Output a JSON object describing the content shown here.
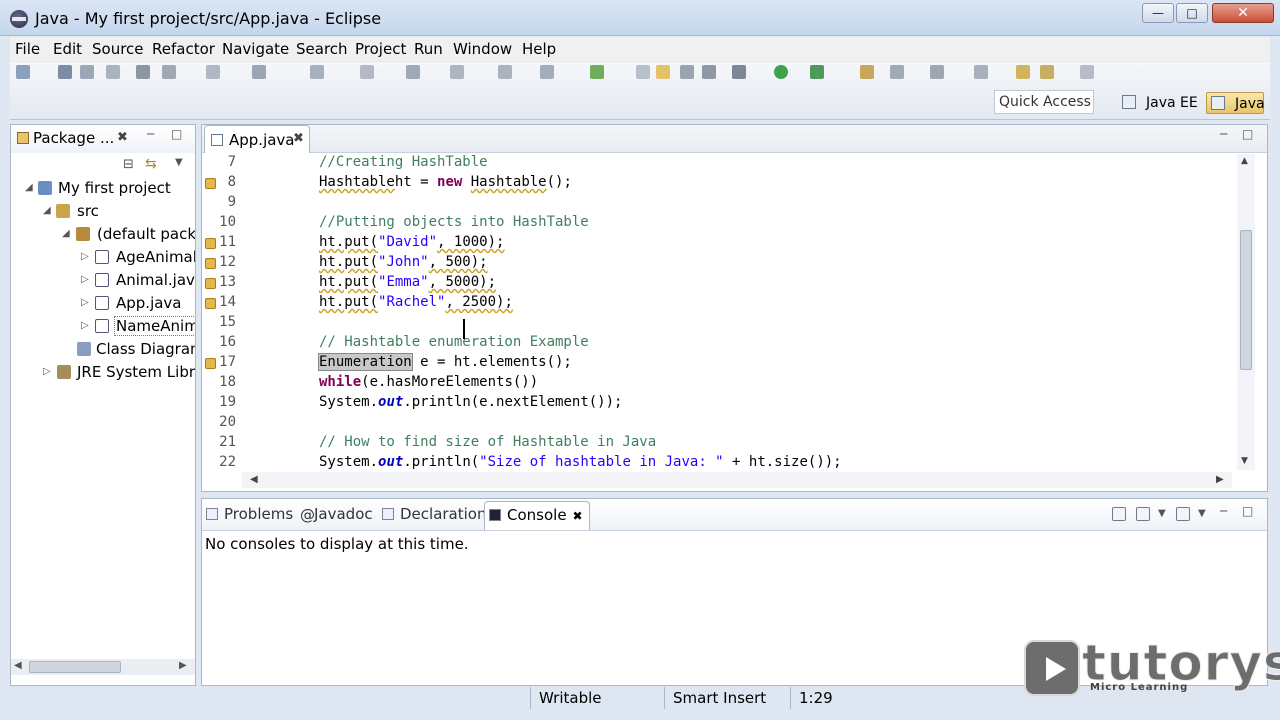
{
  "window": {
    "title": "Java - My first project/src/App.java - Eclipse"
  },
  "menu": [
    "File",
    "Edit",
    "Source",
    "Refactor",
    "Navigate",
    "Search",
    "Project",
    "Run",
    "Window",
    "Help"
  ],
  "toolbar": {
    "quick_access": "Quick Access",
    "perspectives": {
      "javaee": "Java EE",
      "java": "Java"
    }
  },
  "package_explorer": {
    "tab_label": "Package ...",
    "items": [
      {
        "label": "My first project",
        "icon": "project-icon"
      },
      {
        "label": "src",
        "icon": "source-folder-icon"
      },
      {
        "label": "(default package)",
        "icon": "package-icon"
      },
      {
        "label": "AgeAnimalE",
        "icon": "java-file-icon"
      },
      {
        "label": "Animal.java",
        "icon": "java-file-icon"
      },
      {
        "label": "App.java",
        "icon": "java-file-icon"
      },
      {
        "label": "NameAnimal",
        "icon": "java-file-icon"
      },
      {
        "label": "Class Diagram.",
        "icon": "diagram-icon"
      },
      {
        "label": "JRE System Library",
        "icon": "library-icon"
      }
    ]
  },
  "editor": {
    "tab_label": "App.java",
    "lines": [
      {
        "n": "7",
        "marker": false,
        "parts": [
          [
            "cmt",
            "//Creating HashTable"
          ]
        ]
      },
      {
        "n": "8",
        "marker": true,
        "parts": [
          [
            "warn",
            "Hashtable"
          ],
          [
            "",
            "ht = "
          ],
          [
            "kw",
            "new"
          ],
          [
            "",
            " "
          ],
          [
            "warn",
            "Hashtable"
          ],
          [
            "",
            "();"
          ]
        ]
      },
      {
        "n": "9",
        "marker": false,
        "parts": []
      },
      {
        "n": "10",
        "marker": false,
        "parts": [
          [
            "cmt",
            "//Putting objects into HashTable"
          ]
        ]
      },
      {
        "n": "11",
        "marker": true,
        "parts": [
          [
            "warn",
            "ht.put("
          ],
          [
            "str",
            "\"David\""
          ],
          [
            "warn",
            ", 1000);"
          ]
        ]
      },
      {
        "n": "12",
        "marker": true,
        "parts": [
          [
            "warn",
            "ht.put("
          ],
          [
            "str",
            "\"John\""
          ],
          [
            "warn",
            ", 500);"
          ]
        ]
      },
      {
        "n": "13",
        "marker": true,
        "parts": [
          [
            "warn",
            "ht.put("
          ],
          [
            "str",
            "\"Emma\""
          ],
          [
            "warn",
            ", 5000);"
          ]
        ]
      },
      {
        "n": "14",
        "marker": true,
        "parts": [
          [
            "warn",
            "ht.put("
          ],
          [
            "str",
            "\"Rachel\""
          ],
          [
            "warn",
            ", 2500);"
          ]
        ]
      },
      {
        "n": "15",
        "marker": false,
        "parts": []
      },
      {
        "n": "16",
        "marker": false,
        "parts": [
          [
            "cmt",
            "// Hashtable enumeration Example"
          ]
        ]
      },
      {
        "n": "17",
        "marker": true,
        "parts": [
          [
            "hl",
            "Enumeration"
          ],
          [
            "",
            " e = ht.elements();"
          ]
        ]
      },
      {
        "n": "18",
        "marker": false,
        "parts": [
          [
            "kw",
            "while"
          ],
          [
            "",
            "(e.hasMoreElements())"
          ]
        ]
      },
      {
        "n": "19",
        "marker": false,
        "parts": [
          [
            "",
            "System."
          ],
          [
            "fld",
            "out"
          ],
          [
            "",
            ".println(e.nextElement());"
          ]
        ]
      },
      {
        "n": "20",
        "marker": false,
        "parts": []
      },
      {
        "n": "21",
        "marker": false,
        "parts": [
          [
            "cmt",
            "// How to find size of Hashtable in Java"
          ]
        ]
      },
      {
        "n": "22",
        "marker": false,
        "parts": [
          [
            "",
            "System."
          ],
          [
            "fld",
            "out"
          ],
          [
            "",
            ".println("
          ],
          [
            "str",
            "\"Size of hashtable in Java: \""
          ],
          [
            "",
            " + ht.size());"
          ]
        ]
      }
    ]
  },
  "bottom_panel": {
    "tabs": [
      "Problems",
      "Javadoc",
      "Declaration",
      "Console"
    ],
    "active_tab": "Console",
    "message": "No consoles to display at this time."
  },
  "status": {
    "writable": "Writable",
    "insert_mode": "Smart Insert",
    "position": "1:29"
  },
  "watermark": {
    "brand": "tutorys",
    "tagline": "Micro Learning"
  },
  "colors": {
    "comment": "#3f7f5f",
    "keyword": "#7f0055",
    "string": "#2a00ff",
    "field": "#0000c0",
    "active_perspective": "#e9c56a"
  }
}
